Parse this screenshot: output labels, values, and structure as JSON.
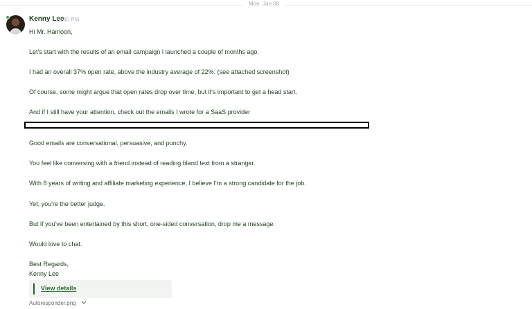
{
  "date_divider": "Mon, Jan 08",
  "message": {
    "sender": "Kenny Lee",
    "time": "10:40 PM",
    "greeting": "Hi Mr. Hamoon,",
    "p1": "Let's start with the results of an email campaign I launched a couple of months ago.",
    "p2": "I had an overall 37% open rate, above the industry average of 22%. (see attached screenshot)",
    "p3": "Of course, some might argue that open rates drop over time, but it's important to get a head start.",
    "p4": "And if I still have your attention, check out the emails I wrote for a SaaS provider",
    "p5": "Good emails are conversational, persuasive, and punchy.",
    "p6": "You feel like conversing with a friend instead of reading bland text from a stranger.",
    "p7": "With 8 years of writing and affiliate marketing experience, I believe I'm a strong candidate for the job.",
    "p8": "Yet, you're the better judge.",
    "p9": "But if you've been entertained by this short, one-sided conversation, drop me a message.",
    "p10": "Would love to chat.",
    "signoff": "Best Regards,",
    "signature": "Kenny Lee"
  },
  "attachment": {
    "view_details_label": "View details",
    "file_name": "Autoresponder.png"
  },
  "icons": {
    "chevron": "chevron-down-icon",
    "status": "online-status-icon"
  },
  "colors": {
    "text": "#1f3d1f",
    "link": "#2f6b2f",
    "online": "#2fb34a"
  }
}
